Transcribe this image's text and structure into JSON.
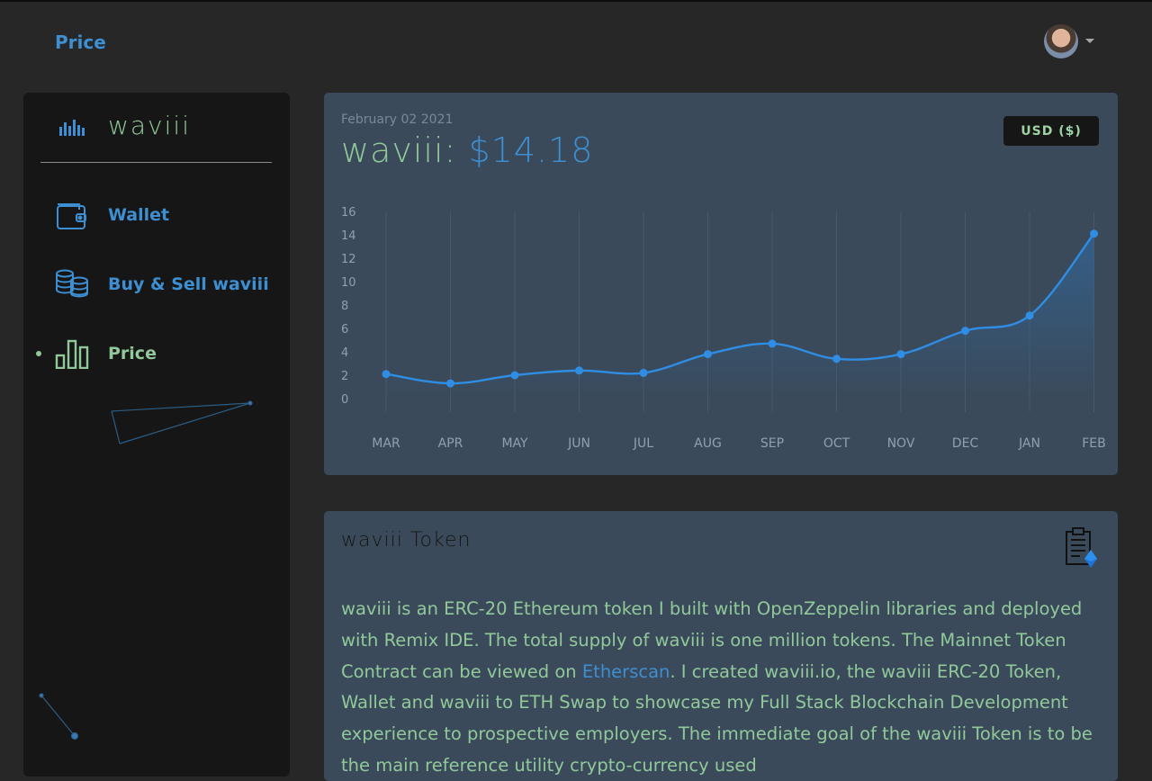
{
  "header": {
    "title": "Price"
  },
  "colors": {
    "background": "#272727",
    "sidebar": "#161616",
    "card": "#3a4a5a",
    "accent_blue": "#3d8fd1",
    "accent_green": "#91c99a"
  },
  "sidebar": {
    "brand": "waviii",
    "items": [
      {
        "label": "Wallet",
        "icon": "wallet-icon"
      },
      {
        "label": "Buy & Sell waviii",
        "icon": "coins-icon"
      },
      {
        "label": "Price",
        "icon": "bar-chart-icon",
        "active": true
      }
    ]
  },
  "price_card": {
    "date": "February 02 2021",
    "token_label": "waviii:",
    "price": "$14.18",
    "currency_button": "USD ($)"
  },
  "chart_data": {
    "type": "line",
    "categories": [
      "MAR",
      "APR",
      "MAY",
      "JUN",
      "JUL",
      "AUG",
      "SEP",
      "OCT",
      "NOV",
      "DEC",
      "JAN",
      "FEB"
    ],
    "values": [
      2.1,
      1.3,
      2.0,
      2.4,
      2.2,
      3.8,
      4.7,
      3.4,
      3.8,
      5.8,
      7.1,
      14.1
    ],
    "y_ticks": [
      "16",
      "14",
      "12",
      "10",
      "8",
      "6",
      "4",
      "2",
      "0"
    ],
    "ylim": [
      0,
      16
    ],
    "grid": "vertical",
    "series_color": "#2f8de4"
  },
  "token_card": {
    "title": "waviii Token",
    "text_1": "waviii is an ERC-20 Ethereum token I built with OpenZeppelin libraries and deployed with Remix IDE. The total supply of waviii is one million tokens. The Mainnet Token Contract can be viewed on ",
    "link": "Etherscan",
    "text_2": ". I created waviii.io, the waviii ERC-20 Token, Wallet and waviii to ETH Swap to showcase my Full Stack Blockchain Development experience to prospective employers. The immediate goal of the waviii Token is to be the main reference utility crypto-currency used"
  }
}
